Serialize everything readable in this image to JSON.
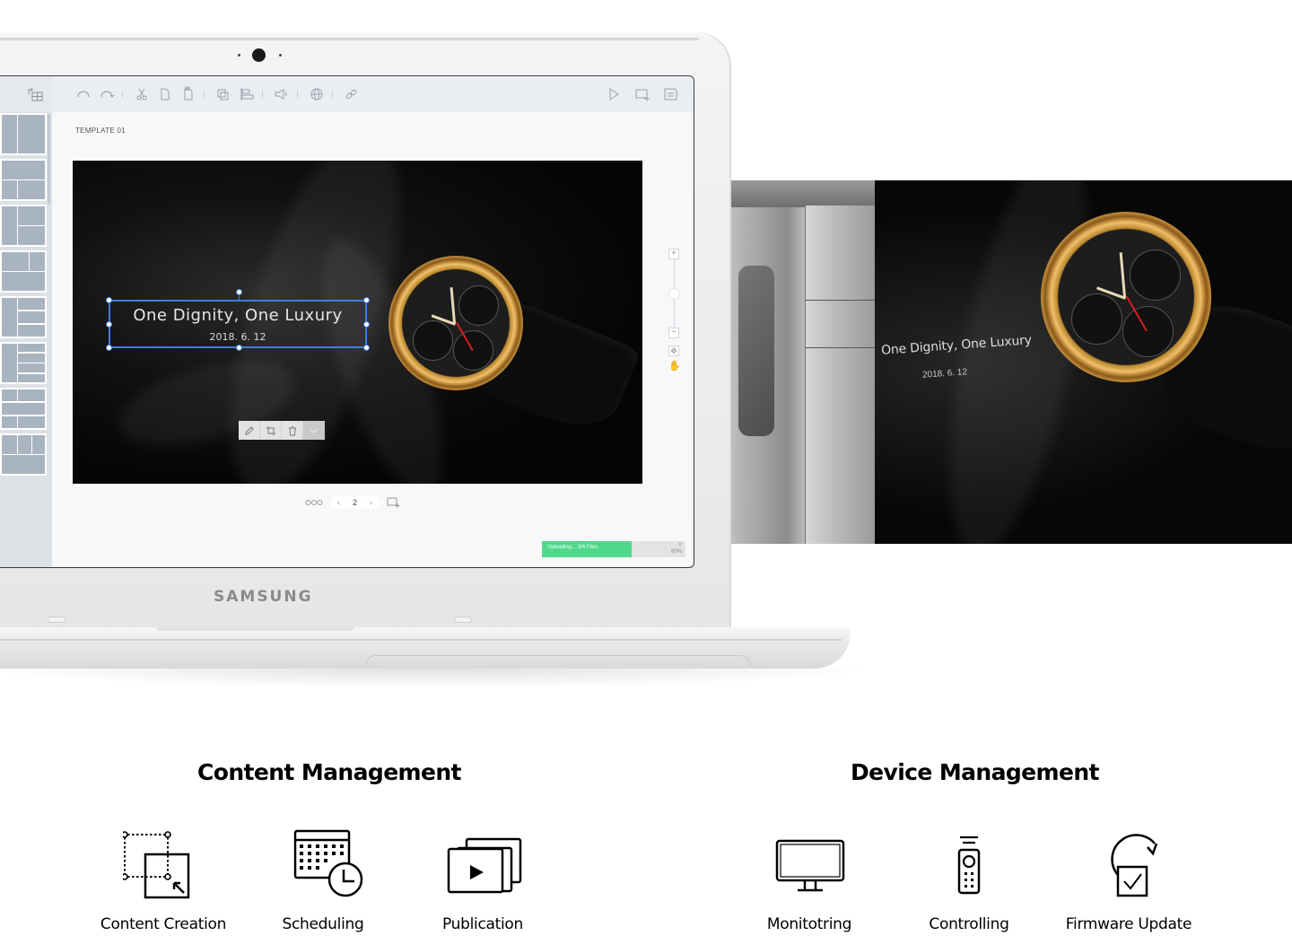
{
  "app": {
    "template_label": "TEMPLATE 01",
    "toolbar": {
      "left_icons": [
        "undo-icon",
        "redo-icon",
        "cut-icon",
        "copy-icon",
        "paste-icon",
        "arrange-icon",
        "align-icon",
        "sound-icon",
        "web-icon",
        "link-icon"
      ],
      "right_icons": [
        "play-icon",
        "add-screen-icon",
        "save-icon"
      ]
    },
    "canvas": {
      "headline": "One Dignity, One Luxury",
      "date": "2018. 6. 12"
    },
    "edit_popup": [
      "edit-icon",
      "crop-icon",
      "delete-icon",
      "confirm-icon"
    ],
    "pager": {
      "prev": "‹",
      "current_page": "2",
      "next": "›"
    },
    "zoom_controls": {
      "zoom_in": "+",
      "zoom_out": "−",
      "zoom_level": 0.5
    },
    "upload": {
      "status_text": "Uploading... 3/4 Files",
      "percent_label": "80%",
      "progress": 0.8,
      "close": "×",
      "color": "#4fd98a"
    }
  },
  "laptop": {
    "brand": "SAMSUNG"
  },
  "billboard": {
    "headline": "One Dignity, One Luxury",
    "date": "2018. 6. 12"
  },
  "sections": [
    {
      "title": "Content Management",
      "features": [
        {
          "label": "Content Creation",
          "icon": "content-creation-icon"
        },
        {
          "label": "Scheduling",
          "icon": "scheduling-icon"
        },
        {
          "label": "Publication",
          "icon": "publication-icon"
        }
      ]
    },
    {
      "title": "Device Management",
      "features": [
        {
          "label": "Monitotring",
          "icon": "monitor-icon"
        },
        {
          "label": "Controlling",
          "icon": "remote-control-icon"
        },
        {
          "label": "Firmware Update",
          "icon": "firmware-update-icon"
        }
      ]
    }
  ]
}
